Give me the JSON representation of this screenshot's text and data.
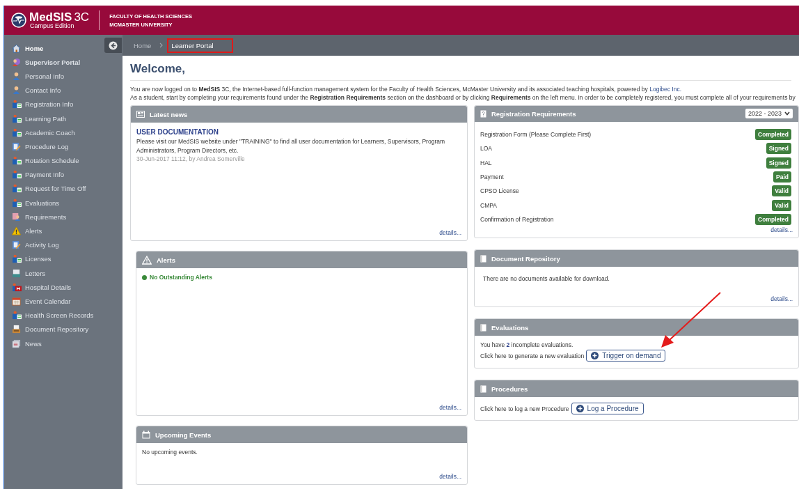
{
  "header": {
    "logo_title": "MedSIS",
    "logo_version": "3C",
    "logo_subtitle": "Campus Edition",
    "org_line_1": "FACULTY OF HEALTH SCIENCES",
    "org_line_2": "MCMASTER UNIVERSITY"
  },
  "sidebar": {
    "items": [
      {
        "label": "Home",
        "kind": "portal",
        "selected": true
      },
      {
        "label": "Supervisor Portal",
        "kind": "portal",
        "selected": false
      },
      {
        "label": "Personal Info",
        "kind": "page",
        "selected": false
      },
      {
        "label": "Contact Info",
        "kind": "page",
        "selected": false
      },
      {
        "label": "Registration Info",
        "kind": "page",
        "selected": false
      },
      {
        "label": "Learning Path",
        "kind": "page",
        "selected": false
      },
      {
        "label": "Academic Coach",
        "kind": "page",
        "selected": false
      },
      {
        "label": "Procedure Log",
        "kind": "page",
        "selected": false
      },
      {
        "label": "Rotation Schedule",
        "kind": "page",
        "selected": false
      },
      {
        "label": "Payment Info",
        "kind": "page",
        "selected": false
      },
      {
        "label": "Request for Time Off",
        "kind": "page",
        "selected": false
      },
      {
        "label": "Evaluations",
        "kind": "page",
        "selected": false
      },
      {
        "label": "Requirements",
        "kind": "page",
        "selected": false
      },
      {
        "label": "Alerts",
        "kind": "page",
        "selected": false
      },
      {
        "label": "Activity Log",
        "kind": "page",
        "selected": false
      },
      {
        "label": "Licenses",
        "kind": "page",
        "selected": false
      },
      {
        "label": "Letters",
        "kind": "page",
        "selected": false
      },
      {
        "label": "Hospital Details",
        "kind": "page",
        "selected": false
      },
      {
        "label": "Event Calendar",
        "kind": "page",
        "selected": false
      },
      {
        "label": "Health Screen Records",
        "kind": "page",
        "selected": false
      },
      {
        "label": "Document Repository",
        "kind": "page",
        "selected": false
      },
      {
        "label": "News",
        "kind": "page",
        "selected": false
      }
    ]
  },
  "breadcrumb": [
    {
      "label": "Home",
      "highlighted": false
    },
    {
      "label": "Learner Portal",
      "highlighted": true
    }
  ],
  "welcome": {
    "title": "Welcome,",
    "intro": "You are now logged on to **MedSIS** 3C, the Internet-based full-function management system for the Faculty of Health Sciences, McMaster University and its associated teaching hospitals, powered by ",
    "intro_link": "Logibec Inc.",
    "instructions": "As a student, start by completing your requirements found under the **Registration Requirements** section on the dashboard or by clicking **Requirements** on the left menu. In order to be completely registered, you must complete all of your requirements by"
  },
  "latest_news": {
    "title": "Latest news",
    "items": [
      {
        "headline": "USER DOCUMENTATION",
        "body": "Please visit our MedSIS website under \"TRAINING\" to find all user documentation for Learners, Supervisors, Program Administrators, Program Directors, etc.",
        "meta": "30-Jun-2017 11:12, by Andrea Somerville"
      }
    ],
    "details_link": "details..."
  },
  "alerts": {
    "title": "Alerts",
    "items": [
      {
        "text": "No Outstanding Alerts"
      }
    ],
    "details_link": "details..."
  },
  "upcoming_events": {
    "title": "Upcoming Events",
    "message": "No upcoming events.",
    "details_link": "details..."
  },
  "registration_requirements": {
    "title": "Registration Requirements",
    "year_select": "2022 - 2023",
    "rows": [
      {
        "name": "Registration Form (Please Complete First)",
        "status": "Completed"
      },
      {
        "name": "LOA",
        "status": "Signed"
      },
      {
        "name": "HAL",
        "status": "Signed"
      },
      {
        "name": "Payment",
        "status": "Paid"
      },
      {
        "name": "CPSO License",
        "status": "Valid"
      },
      {
        "name": "CMPA",
        "status": "Valid"
      },
      {
        "name": "Confirmation of Registration",
        "status": "Completed"
      }
    ],
    "details_link": "details..."
  },
  "document_repository": {
    "title": "Document Repository",
    "message": "There are no documents available for download.",
    "details_link": "details..."
  },
  "evaluations": {
    "title": "Evaluations",
    "summary": "You have **2** incomplete evaluations.",
    "prompt": "Click here to generate a new evaluation",
    "button": "Trigger on demand"
  },
  "procedures": {
    "title": "Procedures",
    "prompt": "Click here to log a new Procedure",
    "button": "Log a Procedure"
  }
}
